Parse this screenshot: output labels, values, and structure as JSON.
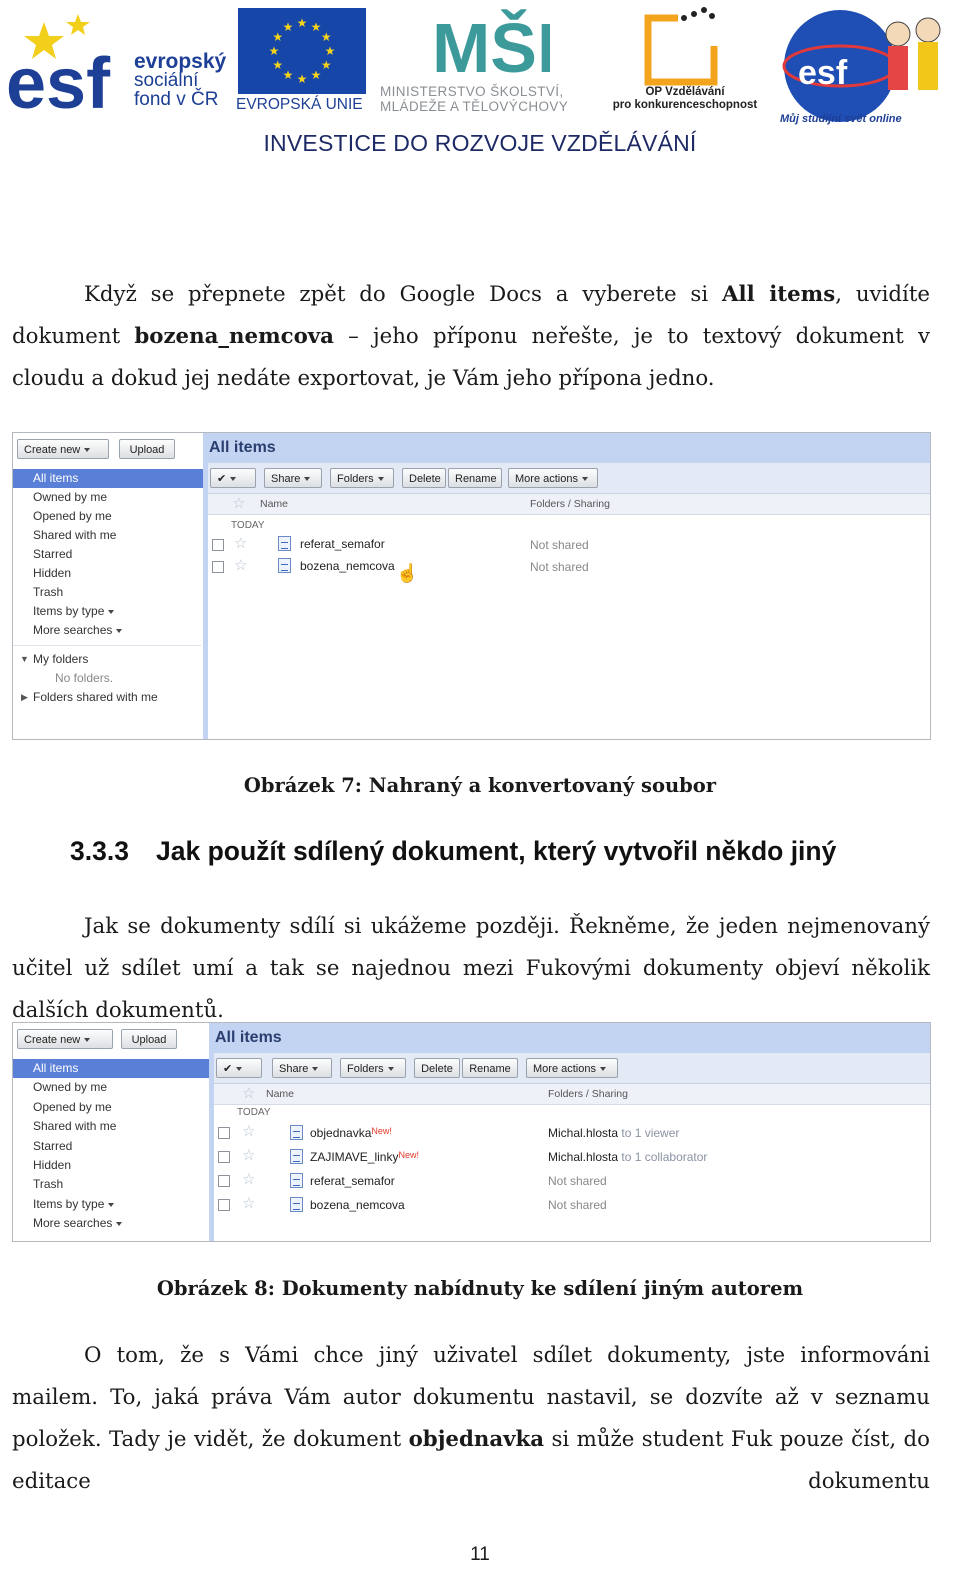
{
  "header": {
    "esf_lines": [
      "evropský",
      "sociální",
      "fond v ČR"
    ],
    "esf_mark": "esf",
    "eu_label": "EVROPSKÁ UNIE",
    "msmt_mark": "MŠMT",
    "msmt_lines": [
      "MINISTERSTVO ŠKOLSTVÍ,",
      "MLÁDEŽE A TĚLOVÝCHOVY"
    ],
    "op_lines": [
      "OP Vzdělávání",
      "pro konkurenceschopnost"
    ],
    "globe_mark": "esf",
    "globe_caption": "Můj studijní svět online",
    "investice": "INVESTICE DO ROZVOJE  VZDĚLÁVÁNÍ"
  },
  "para1": {
    "a": "Když se přepnete zpět do Google Docs a vyberete si ",
    "b": "All items",
    "c": ", uvidíte dokument ",
    "d": "bozena_nemcova",
    "e": " – jeho příponu neřešte, je to textový dokument v cloudu a dokud jej nedáte exportovat,  je Vám jeho přípona jedno."
  },
  "shot1": {
    "create_new": "Create new",
    "upload": "Upload",
    "banner": "All items",
    "nav": [
      "All items",
      "Owned by me",
      "Opened by me",
      "Shared with me",
      "Starred",
      "Hidden",
      "Trash",
      "Items by type",
      "More searches"
    ],
    "folders": {
      "my_folders": "My folders",
      "no_folders": "No folders.",
      "shared": "Folders shared with me"
    },
    "toolbar": {
      "share": "Share",
      "folders": "Folders",
      "delete": "Delete",
      "rename": "Rename",
      "more": "More actions"
    },
    "col_name": "Name",
    "col_sharing": "Folders / Sharing",
    "group": "TODAY",
    "rows": [
      {
        "name": "referat_semafor",
        "sharing": "Not shared"
      },
      {
        "name": "bozena_nemcova",
        "sharing": "Not shared"
      }
    ]
  },
  "caption7": "Obrázek 7: Nahraný a konvertovaný soubor",
  "heading": {
    "num": "3.3.3",
    "text": "Jak použít sdílený dokument, který vytvořil někdo jiný"
  },
  "para2": "Jak se dokumenty sdílí si ukážeme později. Řekněme, že jeden nejmenovaný učitel už sdílet umí a tak se najednou mezi Fukovými dokumenty objeví několik dalších dokumentů.",
  "shot2": {
    "create_new": "Create new",
    "upload": "Upload",
    "banner": "All items",
    "nav": [
      "All items",
      "Owned by me",
      "Opened by me",
      "Shared with me",
      "Starred",
      "Hidden",
      "Trash",
      "Items by type",
      "More searches"
    ],
    "toolbar": {
      "share": "Share",
      "folders": "Folders",
      "delete": "Delete",
      "rename": "Rename",
      "more": "More actions"
    },
    "col_name": "Name",
    "col_sharing": "Folders / Sharing",
    "group": "TODAY",
    "rows": [
      {
        "name": "objednavka",
        "new": "New!",
        "owner": "Michal.hlosta",
        "detail": " to 1 viewer"
      },
      {
        "name": "ZAJIMAVE_linky",
        "new": "New!",
        "owner": "Michal.hlosta",
        "detail": " to 1 collaborator"
      },
      {
        "name": "referat_semafor",
        "new": "",
        "owner": "",
        "detail": "Not shared"
      },
      {
        "name": "bozena_nemcova",
        "new": "",
        "owner": "",
        "detail": "Not shared"
      }
    ]
  },
  "caption8": "Obrázek 8: Dokumenty nabídnuty ke sdílení jiným autorem",
  "para3": {
    "a": "O tom, že s Vámi chce jiný uživatel sdílet dokumenty, jste informováni mailem. To, jaká práva Vám autor dokumentu nastavil, se dozvíte až v seznamu položek. Tady je vidět, že dokument ",
    "b": "objednavka",
    "c": " si může student Fuk pouze číst, do editace dokumentu"
  },
  "page_number": "11"
}
